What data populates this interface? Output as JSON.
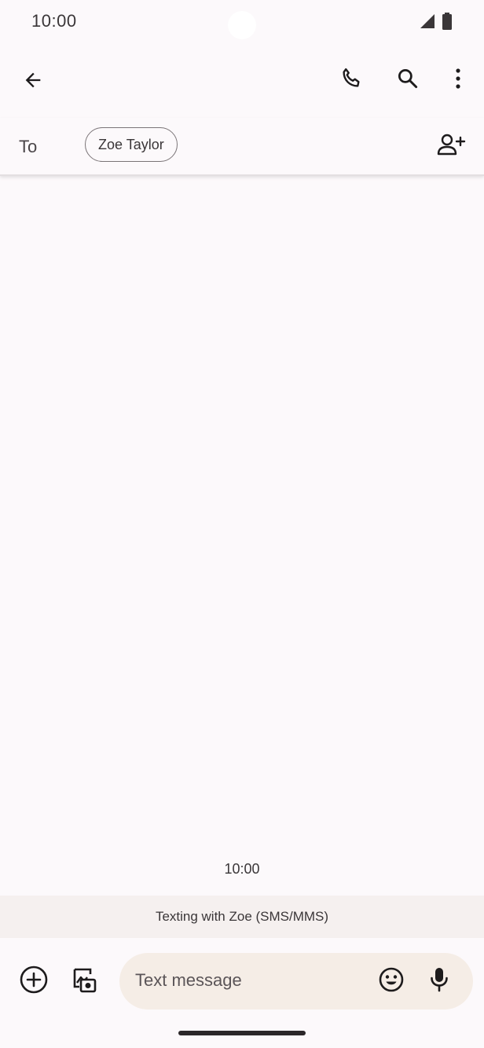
{
  "status_bar": {
    "time": "10:00",
    "icons": [
      "signal-icon",
      "battery-icon"
    ]
  },
  "app_bar": {
    "icons": [
      "back-arrow-icon",
      "phone-icon",
      "search-icon",
      "more-vert-icon"
    ]
  },
  "recipient": {
    "to_label": "To",
    "chip_name": "Zoe Taylor",
    "add_icon": "add-person-icon"
  },
  "conversation": {
    "timestamp": "10:00",
    "banner": "Texting with Zoe (SMS/MMS)"
  },
  "compose": {
    "placeholder": "Text message",
    "icons": [
      "add-circle-icon",
      "gallery-icon",
      "emoji-icon",
      "mic-icon"
    ]
  },
  "colors": {
    "background": "#fcf9fb",
    "compose_field": "#f5ede6",
    "banner": "#f5f0ef",
    "icon": "#1d1b1c"
  }
}
